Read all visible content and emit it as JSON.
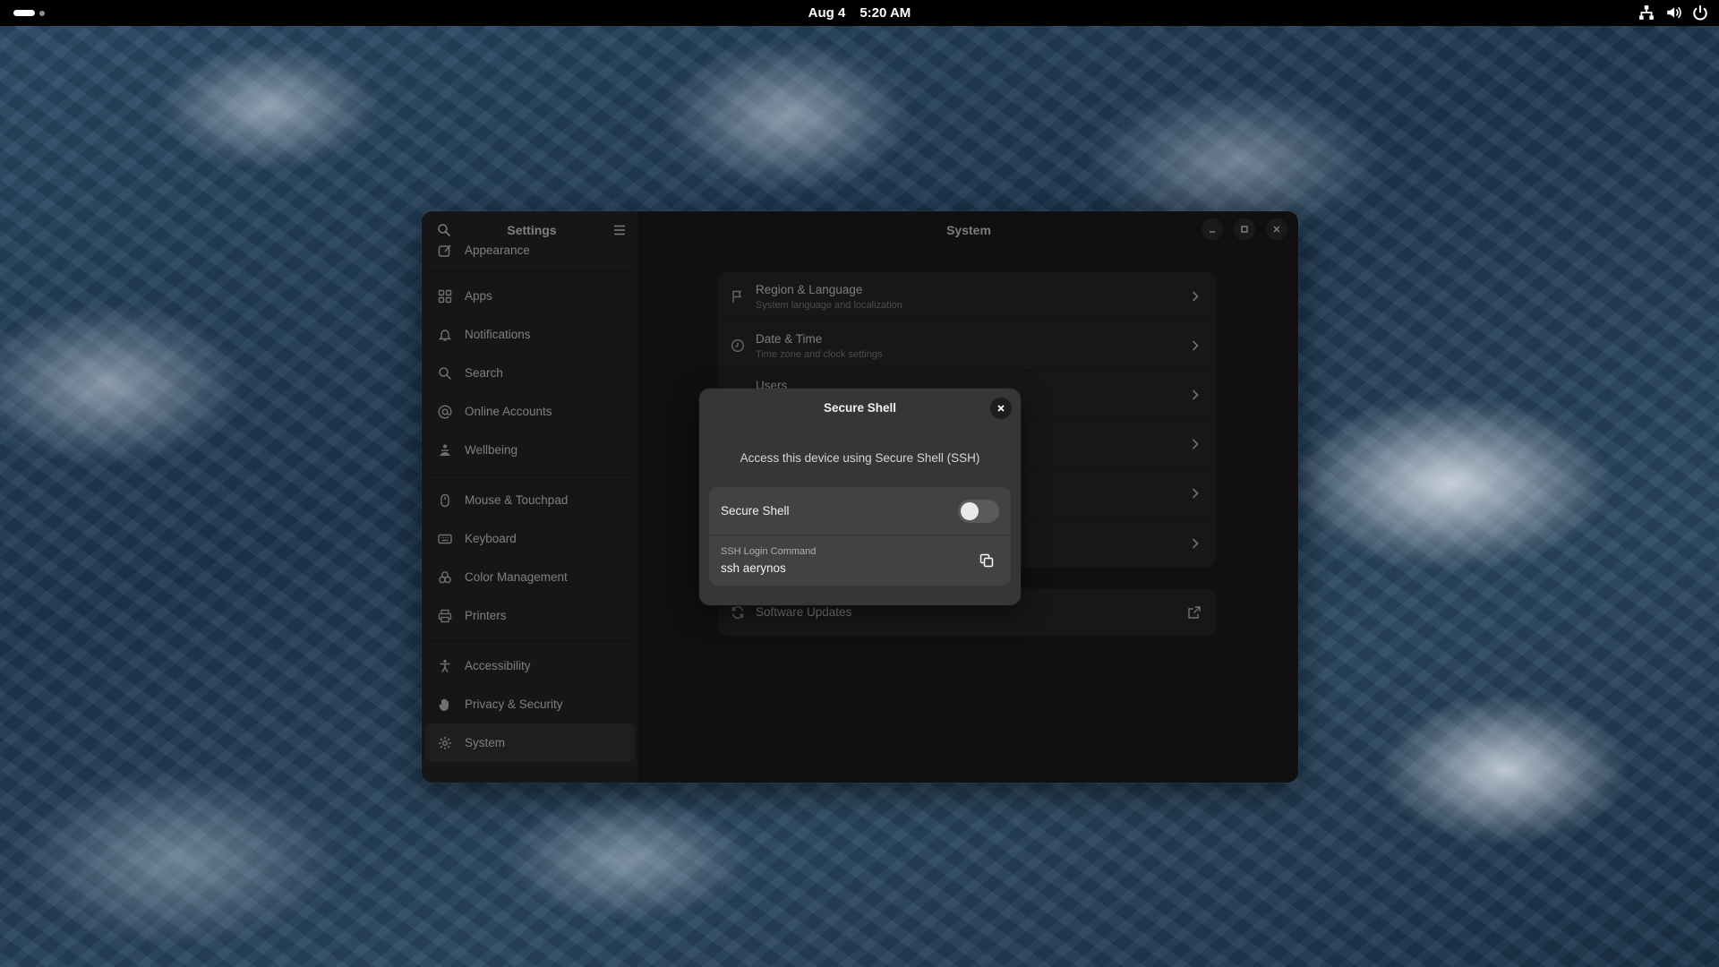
{
  "topbar": {
    "date": "Aug 4",
    "time": "5:20 AM",
    "tray_icons": [
      "network-icon",
      "volume-icon",
      "power-icon"
    ]
  },
  "sidebar": {
    "title": "Settings",
    "items": [
      {
        "label": "Appearance",
        "icon": "appearance-icon"
      },
      {
        "label": "Apps",
        "icon": "apps-icon"
      },
      {
        "label": "Notifications",
        "icon": "bell-icon"
      },
      {
        "label": "Search",
        "icon": "search-icon"
      },
      {
        "label": "Online Accounts",
        "icon": "at-icon"
      },
      {
        "label": "Wellbeing",
        "icon": "wellbeing-icon"
      },
      {
        "label": "Mouse & Touchpad",
        "icon": "mouse-icon"
      },
      {
        "label": "Keyboard",
        "icon": "keyboard-icon"
      },
      {
        "label": "Color Management",
        "icon": "color-icon"
      },
      {
        "label": "Printers",
        "icon": "printer-icon"
      },
      {
        "label": "Accessibility",
        "icon": "accessibility-icon"
      },
      {
        "label": "Privacy & Security",
        "icon": "hand-icon"
      },
      {
        "label": "System",
        "icon": "gear-icon",
        "selected": true
      }
    ]
  },
  "content": {
    "title": "System",
    "rows": [
      {
        "title": "Region & Language",
        "subtitle": "System language and localization",
        "icon": "flag-icon"
      },
      {
        "title": "Date & Time",
        "subtitle": "Time zone and clock settings",
        "icon": "clock-icon"
      },
      {
        "title": "Users",
        "subtitle": "",
        "icon": ""
      },
      {
        "title": "",
        "subtitle": "",
        "icon": ""
      },
      {
        "title": "",
        "subtitle": "",
        "icon": ""
      },
      {
        "title": "",
        "subtitle": "",
        "icon": ""
      }
    ],
    "software_updates": {
      "title": "Software Updates",
      "icon": "refresh-icon"
    }
  },
  "dialog": {
    "title": "Secure Shell",
    "description": "Access this device using Secure Shell (SSH)",
    "toggle_label": "Secure Shell",
    "toggle_on": false,
    "command_caption": "SSH Login Command",
    "command_value": "ssh aerynos"
  },
  "colors": {
    "window_bg": "#1e1e1e",
    "sidebar_bg": "#282828",
    "dialog_bg": "#363636"
  }
}
